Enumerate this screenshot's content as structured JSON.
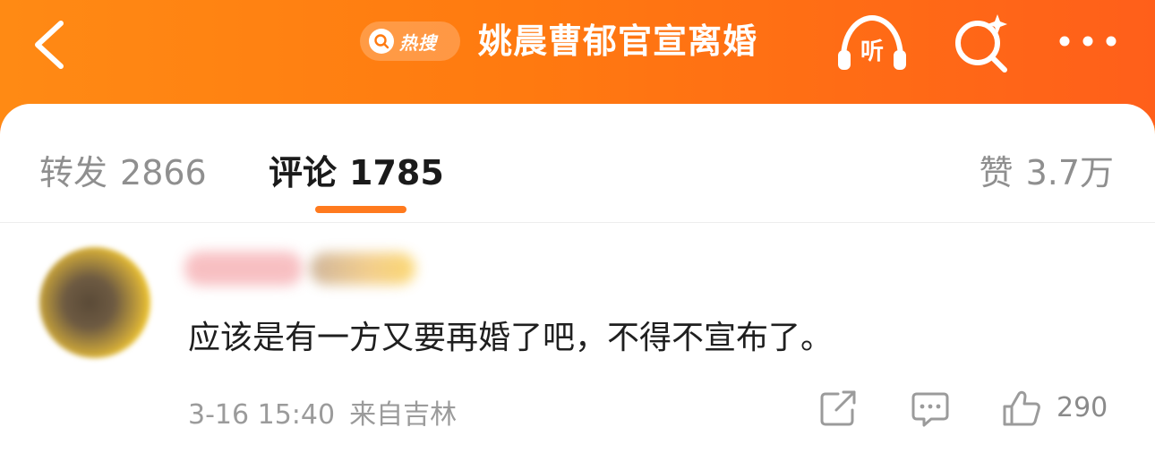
{
  "header": {
    "back_icon": "chevron-left-icon",
    "hot_search_label": "热搜",
    "title": "姚晨曹郁官宣离婚",
    "listen_label": "听",
    "search_icon": "search-sparkle-icon",
    "more_icon": "more-dots-icon",
    "bg_gradient": [
      "#ff8a14",
      "#ff5f1a"
    ]
  },
  "tabs": {
    "repost": {
      "label": "转发",
      "count": "2866"
    },
    "comment": {
      "label": "评论",
      "count": "1785"
    },
    "like": {
      "label": "赞",
      "count": "3.7万"
    },
    "active": "comment",
    "indicator_color": "#ff7a1e"
  },
  "comment": {
    "avatar": "blurred-avatar",
    "username": "",
    "text": "应该是有一方又要再婚了吧，不得不宣布了。",
    "time": "3-16 15:40",
    "location": "来自吉林",
    "like_count": "290",
    "share_icon": "share-icon",
    "reply_icon": "comment-icon",
    "like_icon": "thumbs-up-icon"
  }
}
